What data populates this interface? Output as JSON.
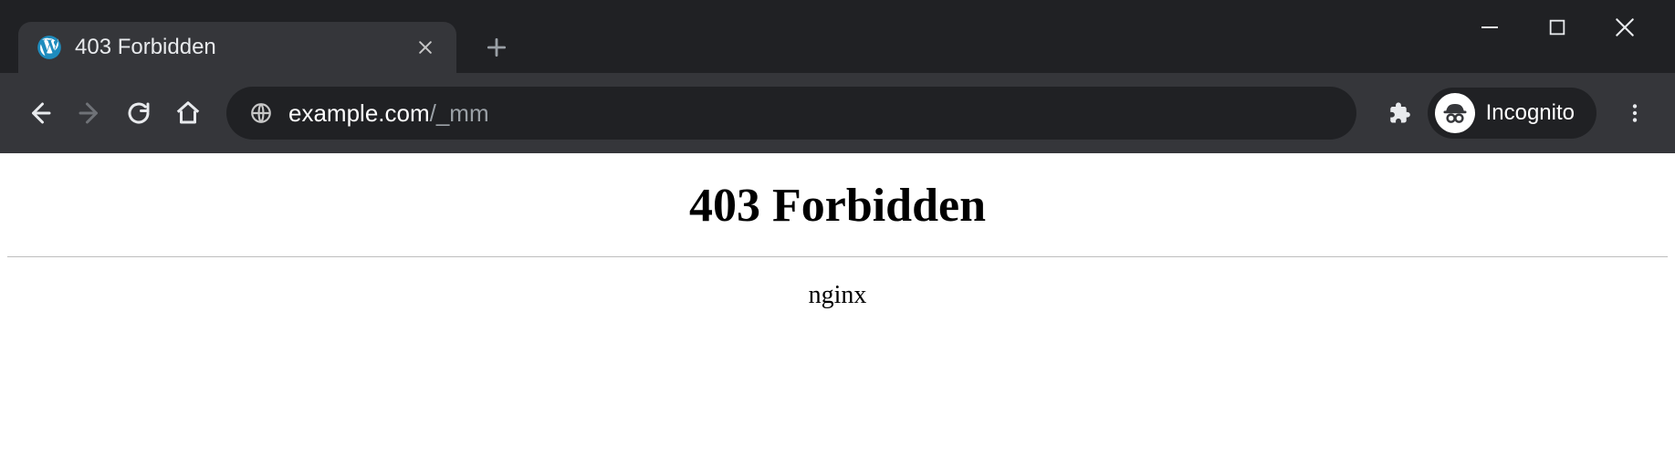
{
  "tab": {
    "title": "403 Forbidden"
  },
  "address": {
    "domain": "example.com",
    "path": "/_mm"
  },
  "incognito": {
    "label": "Incognito"
  },
  "page": {
    "heading": "403 Forbidden",
    "server": "nginx"
  }
}
